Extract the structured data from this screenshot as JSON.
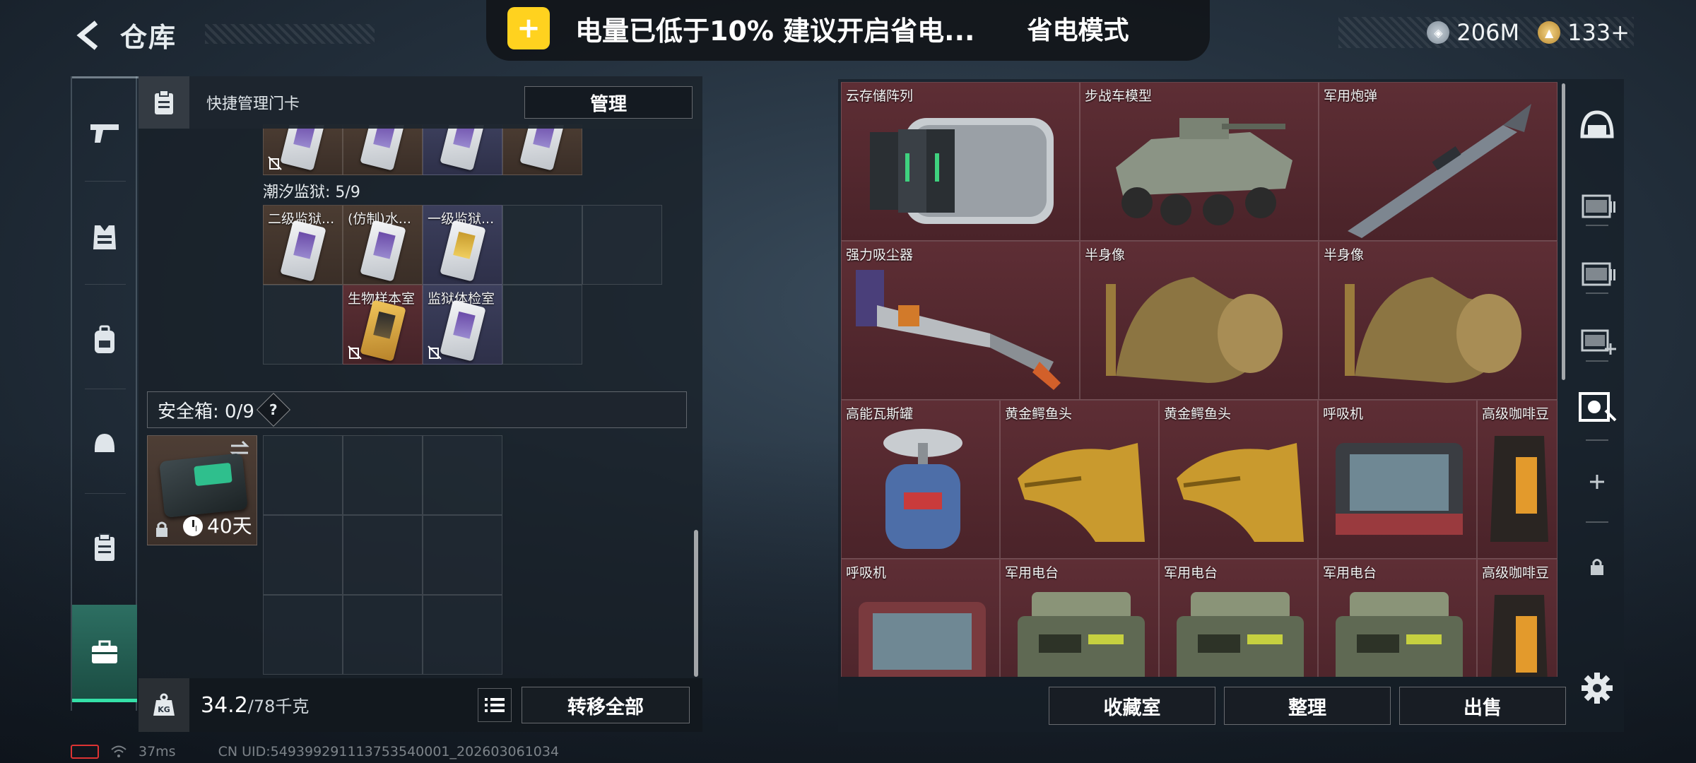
{
  "header": {
    "title": "仓库",
    "notification_text": "电量已低于10% 建议开启省电...",
    "notification_action": "省电模式",
    "currency": [
      {
        "icon": "silver-coin-icon",
        "value": "206M"
      },
      {
        "icon": "gold-coin-icon",
        "value": "133+"
      }
    ]
  },
  "leftnav": {
    "items": [
      "gun-icon",
      "armor-vest-icon",
      "backpack-icon",
      "helmet-icon",
      "clipboard-icon",
      "briefcase-icon"
    ],
    "active": "briefcase-icon"
  },
  "left_panel": {
    "quick_label": "快捷管理门卡",
    "manage_label": "管理",
    "section_title": "潮汐监狱: 5/9",
    "cards": [
      {
        "label": "二级监狱...",
        "color": "brown",
        "disabled": false
      },
      {
        "label": "(仿制)水...",
        "color": "brown",
        "disabled": false
      },
      {
        "label": "一级监狱...",
        "color": "navy",
        "disabled": false
      },
      {
        "label": "生物样本室",
        "color": "maroon",
        "disabled": true
      },
      {
        "label": "监狱体检室",
        "color": "navy",
        "disabled": true
      }
    ],
    "safebox_label": "安全箱: 0/9",
    "help_label": "?",
    "safebox_days": "40天",
    "weight_value": "34.2",
    "weight_max": "/78千克",
    "kg_label": "KG",
    "transfer_label": "转移全部"
  },
  "stash": {
    "items": [
      {
        "label": "云存储阵列"
      },
      {
        "label": "步战车模型"
      },
      {
        "label": "军用炮弹"
      },
      {
        "label": "强力吸尘器"
      },
      {
        "label": "半身像"
      },
      {
        "label": "半身像"
      },
      {
        "label": "高能瓦斯罐"
      },
      {
        "label": "黄金鳄鱼头"
      },
      {
        "label": "黄金鳄鱼头"
      },
      {
        "label": "呼吸机"
      },
      {
        "label": "高级咖啡豆"
      },
      {
        "label": "呼吸机"
      },
      {
        "label": "军用电台"
      },
      {
        "label": "军用电台"
      },
      {
        "label": "军用电台"
      },
      {
        "label": "高级咖啡豆"
      }
    ],
    "buttons": {
      "collection": "收藏室",
      "organize": "整理",
      "sell": "出售"
    }
  },
  "statusbar": {
    "ping": "37ms",
    "uid": "CN UID:549399291113753540001_202603061034"
  }
}
